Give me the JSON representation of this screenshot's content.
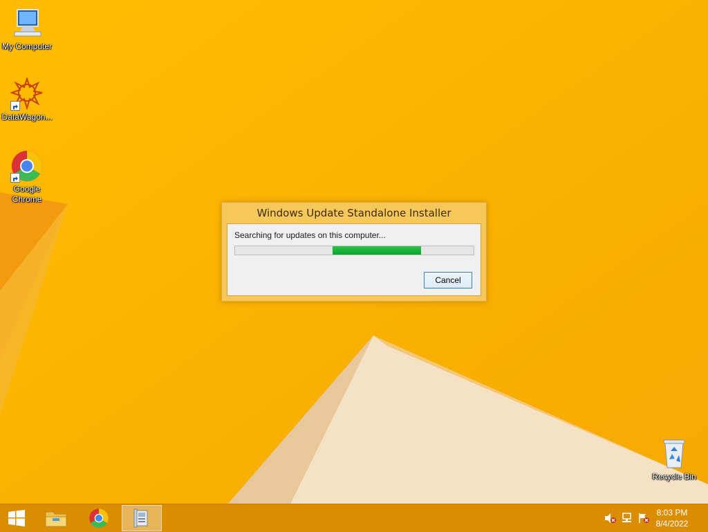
{
  "desktop": {
    "icons": [
      {
        "label": "My Computer"
      },
      {
        "label": "DataWagon..."
      },
      {
        "label": "Google Chrome"
      },
      {
        "label": "Recycle Bin"
      }
    ]
  },
  "dialog": {
    "title": "Windows Update Standalone Installer",
    "status": "Searching for updates on this computer...",
    "progress_fraction": 0.37,
    "cancel_label": "Cancel"
  },
  "taskbar": {
    "start_icon": "windows-logo-icon",
    "pinned": [
      "file-explorer-icon",
      "chrome-icon",
      "installer-icon"
    ],
    "tray_icons": [
      "volume-muted-icon",
      "network-icon",
      "action-center-icon"
    ],
    "clock": {
      "time": "8:03 PM",
      "date": "8/4/2022"
    }
  },
  "colors": {
    "wallpaper": "#f8b400",
    "progress": "#06a72c",
    "dialog_frame": "#f6c85a"
  }
}
